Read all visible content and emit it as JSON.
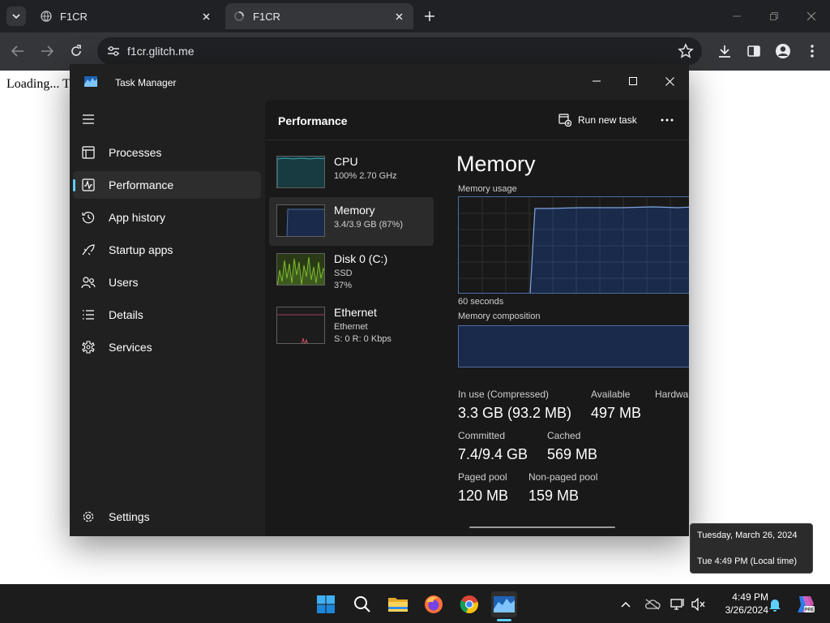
{
  "browser": {
    "tabs": [
      {
        "title": "F1CR"
      },
      {
        "title": "F1CR"
      }
    ],
    "url": "f1cr.glitch.me"
  },
  "page": {
    "loading_text": "Loading... T"
  },
  "task_manager": {
    "window_title": "Task Manager",
    "nav": [
      {
        "label": "Processes",
        "icon": "processes-icon"
      },
      {
        "label": "Performance",
        "icon": "performance-icon"
      },
      {
        "label": "App history",
        "icon": "app-history-icon"
      },
      {
        "label": "Startup apps",
        "icon": "startup-apps-icon"
      },
      {
        "label": "Users",
        "icon": "users-icon"
      },
      {
        "label": "Details",
        "icon": "details-icon"
      },
      {
        "label": "Services",
        "icon": "services-icon"
      }
    ],
    "settings_label": "Settings",
    "header": {
      "title": "Performance",
      "run_new_task": "Run new task"
    },
    "resources": [
      {
        "name": "CPU",
        "line1": "100% 2.70 GHz",
        "line2": ""
      },
      {
        "name": "Memory",
        "line1": "3.4/3.9 GB (87%)",
        "line2": ""
      },
      {
        "name": "Disk 0 (C:)",
        "line1": "SSD",
        "line2": "37%"
      },
      {
        "name": "Ethernet",
        "line1": "Ethernet",
        "line2": "S: 0 R: 0 Kbps"
      }
    ],
    "detail": {
      "title": "Memory",
      "usage_label": "Memory usage",
      "time_label": "60 seconds",
      "composition_label": "Memory composition",
      "stats": {
        "in_use_label": "In use (Compressed)",
        "in_use_value": "3.3 GB (93.2 MB)",
        "available_label": "Available",
        "available_value": "497 MB",
        "hardware_label": "Hardwa",
        "committed_label": "Committed",
        "committed_value": "7.4/9.4 GB",
        "cached_label": "Cached",
        "cached_value": "569 MB",
        "paged_label": "Paged pool",
        "paged_value": "120 MB",
        "nonpaged_label": "Non-paged pool",
        "nonpaged_value": "159 MB"
      }
    }
  },
  "tooltip": {
    "date": "Tuesday, March 26, 2024",
    "time": "Tue 4:49 PM (Local time)"
  },
  "taskbar": {
    "time": "4:49 PM",
    "date": "3/26/2024",
    "pinned": [
      "start-icon",
      "search-icon",
      "file-explorer-icon",
      "firefox-icon",
      "chrome-icon",
      "task-manager-icon"
    ]
  },
  "colors": {
    "accent": "#60cdff",
    "memory_fill": "#1a2a4a",
    "memory_line": "#4b6ea4",
    "cpu_line": "#3aa6b3",
    "disk_line": "#7dbb2f",
    "net_line": "#d24b6c"
  }
}
